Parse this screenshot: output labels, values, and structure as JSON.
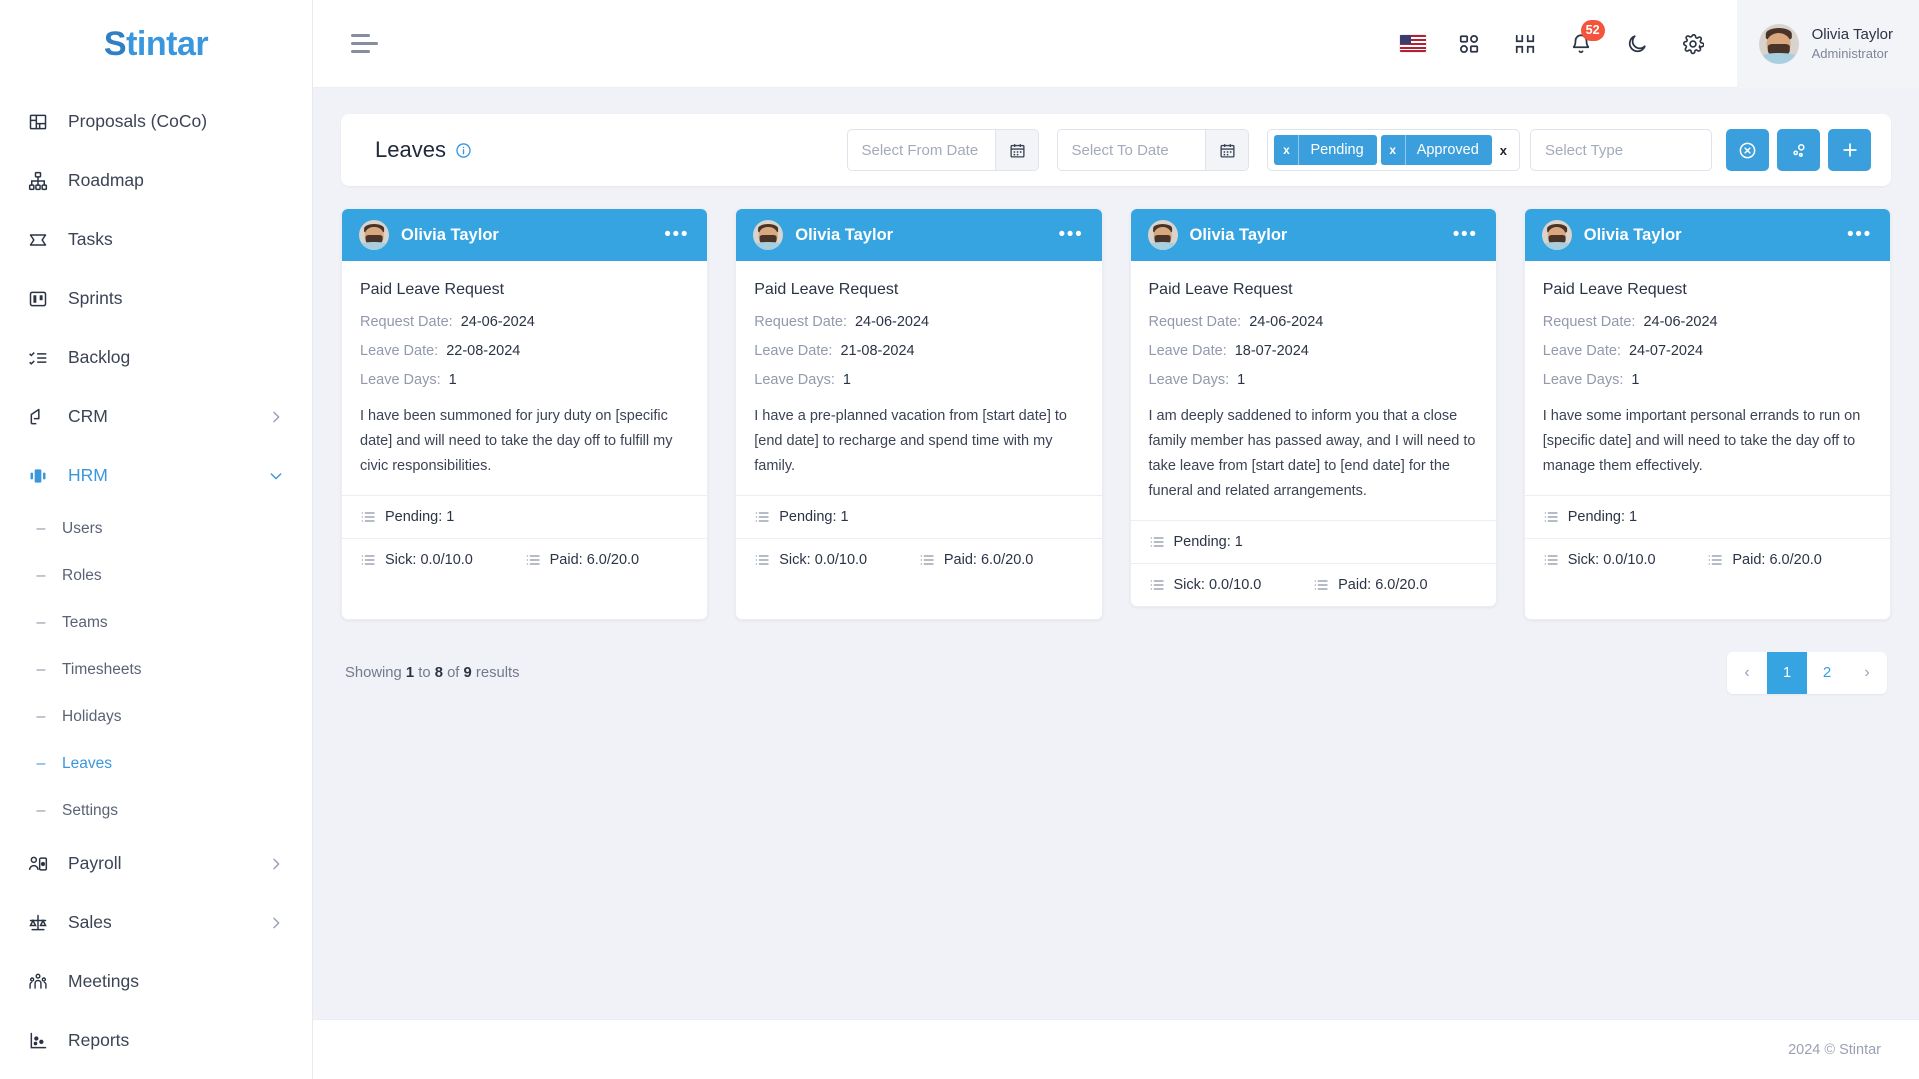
{
  "brand": {
    "name": "Stintar",
    "first_letter": "S",
    "rest": "tintar"
  },
  "sidebar": {
    "items": [
      {
        "label": "Proposals (CoCo)",
        "icon": "proposals-icon",
        "has_chevron": false,
        "active": false
      },
      {
        "label": "Roadmap",
        "icon": "roadmap-icon",
        "has_chevron": false,
        "active": false
      },
      {
        "label": "Tasks",
        "icon": "tasks-icon",
        "has_chevron": false,
        "active": false
      },
      {
        "label": "Sprints",
        "icon": "sprints-icon",
        "has_chevron": false,
        "active": false
      },
      {
        "label": "Backlog",
        "icon": "backlog-icon",
        "has_chevron": false,
        "active": false
      },
      {
        "label": "CRM",
        "icon": "crm-icon",
        "has_chevron": true,
        "active": false
      },
      {
        "label": "HRM",
        "icon": "hrm-icon",
        "has_chevron": true,
        "active": true
      }
    ],
    "hrm_children": [
      {
        "label": "Users",
        "active": false
      },
      {
        "label": "Roles",
        "active": false
      },
      {
        "label": "Teams",
        "active": false
      },
      {
        "label": "Timesheets",
        "active": false
      },
      {
        "label": "Holidays",
        "active": false
      },
      {
        "label": "Leaves",
        "active": true
      },
      {
        "label": "Settings",
        "active": false
      }
    ],
    "items_after": [
      {
        "label": "Payroll",
        "icon": "payroll-icon",
        "has_chevron": true,
        "active": false
      },
      {
        "label": "Sales",
        "icon": "sales-icon",
        "has_chevron": true,
        "active": false
      },
      {
        "label": "Meetings",
        "icon": "meetings-icon",
        "has_chevron": false,
        "active": false
      },
      {
        "label": "Reports",
        "icon": "reports-icon",
        "has_chevron": false,
        "active": false
      }
    ]
  },
  "topbar": {
    "menu_icon": "hamburger-icon",
    "language_flag": "us-flag-icon",
    "apps_icon": "apps-grid-icon",
    "fullscreen_icon": "collapse-screen-icon",
    "notifications_icon": "bell-icon",
    "notifications_count": "52",
    "theme_icon": "moon-icon",
    "settings_icon": "gear-icon",
    "user": {
      "name": "Olivia Taylor",
      "role": "Administrator"
    }
  },
  "filterbar": {
    "title": "Leaves",
    "info_icon": "info-icon",
    "from_date": {
      "value": "",
      "placeholder": "Select From Date",
      "calendar_icon": "calendar-icon"
    },
    "to_date": {
      "value": "",
      "placeholder": "Select To Date",
      "calendar_icon": "calendar-icon"
    },
    "tags": [
      {
        "label": "Pending",
        "remove": "x"
      },
      {
        "label": "Approved",
        "remove": "x"
      }
    ],
    "tags_clear": "x",
    "type_select": {
      "value": "",
      "placeholder": "Select Type"
    },
    "actions": [
      {
        "name": "clear-filters-button",
        "icon": "circle-x-icon"
      },
      {
        "name": "filter-settings-button",
        "icon": "share-nodes-icon"
      },
      {
        "name": "add-leave-button",
        "icon": "plus-icon"
      }
    ]
  },
  "cards": [
    {
      "user": "Olivia Taylor",
      "menu": "•••",
      "title": "Paid Leave Request",
      "request_date_label": "Request Date:",
      "request_date": "24-06-2024",
      "leave_date_label": "Leave Date:",
      "leave_date": "22-08-2024",
      "leave_days_label": "Leave Days:",
      "leave_days": "1",
      "description": "I have been summoned for jury duty on [specific date] and will need to take the day off to fulfill my civic responsibilities.",
      "status": "Pending: 1",
      "sick": "Sick: 0.0/10.0",
      "paid": "Paid: 6.0/20.0"
    },
    {
      "user": "Olivia Taylor",
      "menu": "•••",
      "title": "Paid Leave Request",
      "request_date_label": "Request Date:",
      "request_date": "24-06-2024",
      "leave_date_label": "Leave Date:",
      "leave_date": "21-08-2024",
      "leave_days_label": "Leave Days:",
      "leave_days": "1",
      "description": "I have a pre-planned vacation from [start date] to [end date] to recharge and spend time with my family.",
      "status": "Pending: 1",
      "sick": "Sick: 0.0/10.0",
      "paid": "Paid: 6.0/20.0"
    },
    {
      "user": "Olivia Taylor",
      "menu": "•••",
      "title": "Paid Leave Request",
      "request_date_label": "Request Date:",
      "request_date": "24-06-2024",
      "leave_date_label": "Leave Date:",
      "leave_date": "18-07-2024",
      "leave_days_label": "Leave Days:",
      "leave_days": "1",
      "description": "I am deeply saddened to inform you that a close family member has passed away, and I will need to take leave from [start date] to [end date] for the funeral and related arrangements.",
      "status": "Pending: 1",
      "sick": "Sick: 0.0/10.0",
      "paid": "Paid: 6.0/20.0"
    },
    {
      "user": "Olivia Taylor",
      "menu": "•••",
      "title": "Paid Leave Request",
      "request_date_label": "Request Date:",
      "request_date": "24-06-2024",
      "leave_date_label": "Leave Date:",
      "leave_date": "24-07-2024",
      "leave_days_label": "Leave Days:",
      "leave_days": "1",
      "description": "I have some important personal errands to run on [specific date] and will need to take the day off to manage them effectively.",
      "status": "Pending: 1",
      "sick": "Sick: 0.0/10.0",
      "paid": "Paid: 6.0/20.0"
    }
  ],
  "pagination": {
    "showing_prefix": "Showing",
    "from": "1",
    "to_word": "to",
    "to": "8",
    "of_word": "of",
    "total": "9",
    "results_word": "results",
    "prev": "‹",
    "pages": [
      {
        "label": "1",
        "active": true
      },
      {
        "label": "2",
        "active": false
      }
    ],
    "next": "›"
  },
  "footer": {
    "copyright": "2024 © Stintar"
  },
  "colors": {
    "accent": "#35a4e0",
    "tag": "#3a9fdc",
    "badge": "#f4543c",
    "page_bg": "#f1f2f7",
    "sidebar_bg": "#ffffff"
  }
}
